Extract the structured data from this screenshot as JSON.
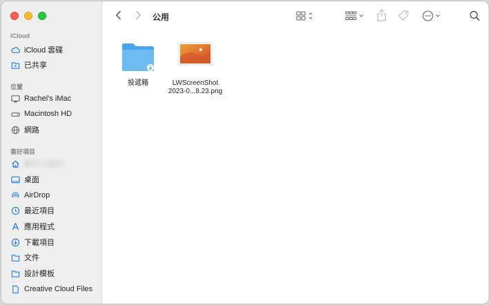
{
  "window": {
    "title": "公用"
  },
  "sidebar": {
    "sections": [
      {
        "title": "iCloud",
        "items": [
          {
            "label": "iCloud 雲碟",
            "icon": "cloud-icon"
          },
          {
            "label": "已共享",
            "icon": "shared-folder-icon"
          }
        ]
      },
      {
        "title": "位置",
        "items": [
          {
            "label": "Rachel's iMac",
            "icon": "imac-icon"
          },
          {
            "label": "Macintosh HD",
            "icon": "hard-drive-icon"
          },
          {
            "label": "網路",
            "icon": "network-icon"
          }
        ]
      },
      {
        "title": "喜好項目",
        "items": [
          {
            "label": "",
            "icon": "home-icon"
          },
          {
            "label": "桌面",
            "icon": "desktop-icon"
          },
          {
            "label": "AirDrop",
            "icon": "airdrop-icon"
          },
          {
            "label": "最近項目",
            "icon": "clock-icon"
          },
          {
            "label": "應用程式",
            "icon": "applications-icon"
          },
          {
            "label": "下載項目",
            "icon": "download-icon"
          },
          {
            "label": "文件",
            "icon": "document-icon"
          },
          {
            "label": "設計模板",
            "icon": "folder-icon"
          },
          {
            "label": "Creative Cloud Files",
            "icon": "creative-cloud-file-icon"
          }
        ]
      }
    ]
  },
  "files": [
    {
      "name": "投遞箱",
      "type": "drop-box-folder"
    },
    {
      "name": "LWScreenShot\n2023-0...8.23.png",
      "type": "image"
    }
  ],
  "colors": {
    "accent": "#1e7ce8",
    "folder": "#5fb3ee",
    "sidebar_bg": "#efefef"
  }
}
